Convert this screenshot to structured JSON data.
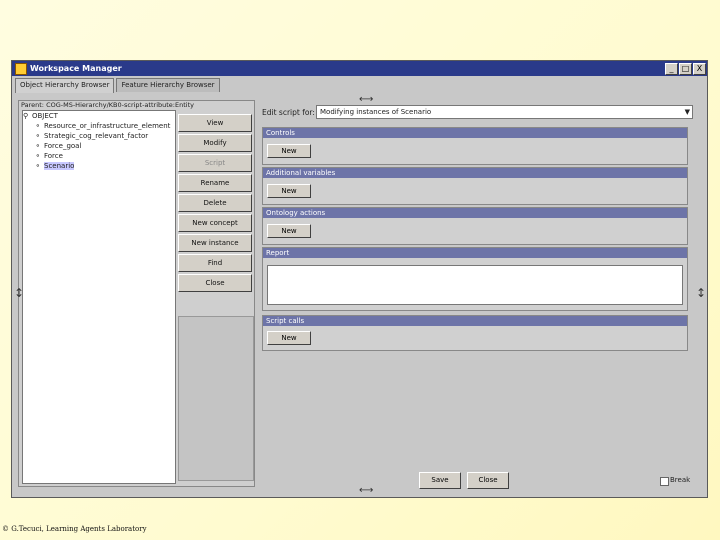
{
  "window": {
    "title": "Workspace Manager",
    "controls": [
      "_",
      "□",
      "X"
    ]
  },
  "tabs": [
    {
      "label": "Object Hierarchy Browser"
    },
    {
      "label": "Feature Hierarchy Browser"
    }
  ],
  "left": {
    "path": "Parent: COG-MS-Hierarchy/KB0-script-attribute:Entity",
    "tree": [
      {
        "key": "⚲",
        "label": "OBJECT"
      },
      {
        "key": "⚬",
        "label": "Resource_or_infrastructure_element"
      },
      {
        "key": "⚬",
        "label": "Strategic_cog_relevant_factor"
      },
      {
        "key": "⚬",
        "label": "Force_goal"
      },
      {
        "key": "⚬",
        "label": "Force"
      },
      {
        "key": "⚬",
        "label": "Scenario"
      }
    ],
    "buttons": {
      "view": "View",
      "modify": "Modify",
      "script": "Script",
      "rename": "Rename",
      "delete": "Delete",
      "new_concept": "New concept",
      "new_instance": "New instance",
      "find": "Find",
      "close": "Close"
    }
  },
  "right": {
    "edit_label": "Edit script for:",
    "edit_value": "Modifying instances of Scenario",
    "sections": {
      "controls": {
        "header": "Controls",
        "button": "New"
      },
      "additional": {
        "header": "Additional variables",
        "button": "New"
      },
      "ontology": {
        "header": "Ontology actions",
        "button": "New"
      },
      "report": {
        "header": "Report"
      },
      "script_calls": {
        "header": "Script calls",
        "button": "New"
      }
    },
    "bottom": {
      "save": "Save",
      "close": "Close",
      "checkbox_label": "Break"
    }
  },
  "footer": "© G.Tecuci, Learning Agents Laboratory",
  "icons": {
    "top_resize": "horizontal-resize-icon",
    "side_resize": "vertical-resize-icon"
  }
}
